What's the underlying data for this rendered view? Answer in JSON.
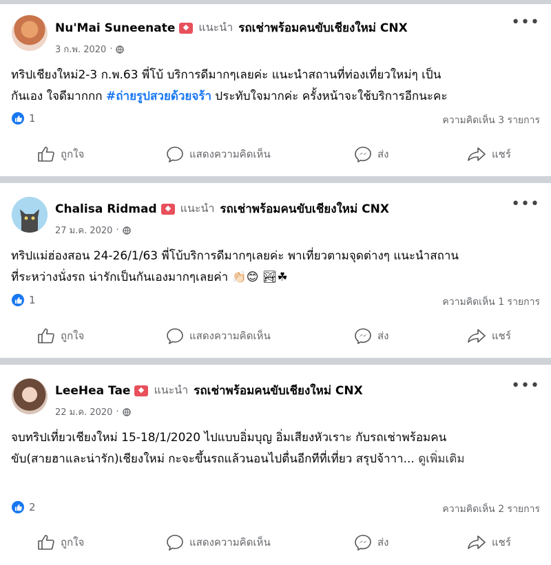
{
  "posts": [
    {
      "author": "Nu'Mai Suneenate",
      "recommends": "แนะนำ",
      "page": "รถเช่าพร้อมคนขับเชียงใหม่ CNX",
      "date": "3 ก.พ. 2020",
      "line1": "ทริปเชียงใหม่2-3 ก.พ.63 พี่โบ้ บริการดีมากๆเลยค่ะ แนะนำสถานที่ท่องเที่ยวใหม่ๆ เป็น",
      "line2_pre": "กันเอง ใจดีมากกก ",
      "hashtag": "#ถ่ายรูปสวยด้วยจร้า",
      "line2_post": " ประทับใจมากค่ะ ครั้งหน้าจะใช้บริการอีกนะคะ",
      "likes": "1",
      "comments": "ความคิดเห็น 3 รายการ"
    },
    {
      "author": "Chalisa Ridmad",
      "recommends": "แนะนำ",
      "page": "รถเช่าพร้อมคนขับเชียงใหม่ CNX",
      "date": "27 ม.ค. 2020",
      "line1": "ทริปแม่ฮ่องสอน 24-26/1/63 พี่โบ้บริการดีมากๆเลยค่ะ พาเที่ยวตามจุดต่างๆ แนะนำสถาน",
      "line2": "ที่ระหว่างนั่งรถ น่ารักเป็นกันเองมากๆเลยค่า 👏🏻😊 🏞☘",
      "likes": "1",
      "comments": "ความคิดเห็น 1 รายการ"
    },
    {
      "author": "LeeHea Tae",
      "recommends": "แนะนำ",
      "page": "รถเช่าพร้อมคนขับเชียงใหม่ CNX",
      "date": "22 ม.ค. 2020",
      "line1": "จบทริปเที่ยวเชียงใหม่ 15-18/1/2020 ไปแบบอิ่มบุญ อิ่มเสียงหัวเราะ กับรถเช่าพร้อมคน",
      "line2": "ขับ(สายฮาและน่ารัก)เชียงใหม่ กะจะขึ้นรถแล้วนอนไปตื่นอีกทีที่เที่ยว สรุปจ้าาา... ",
      "see_more": "ดูเพิ่มเติม",
      "likes": "2",
      "comments": "ความคิดเห็น 2 รายการ"
    }
  ],
  "actions": {
    "like": "ถูกใจ",
    "comment": "แสดงความคิดเห็น",
    "send": "ส่ง",
    "share": "แชร์"
  },
  "more_glyph": "•••",
  "colors": {
    "accent": "#1877f2",
    "muted": "#65676b",
    "separator": "#cfd2d7",
    "badge": "#e8505b"
  }
}
